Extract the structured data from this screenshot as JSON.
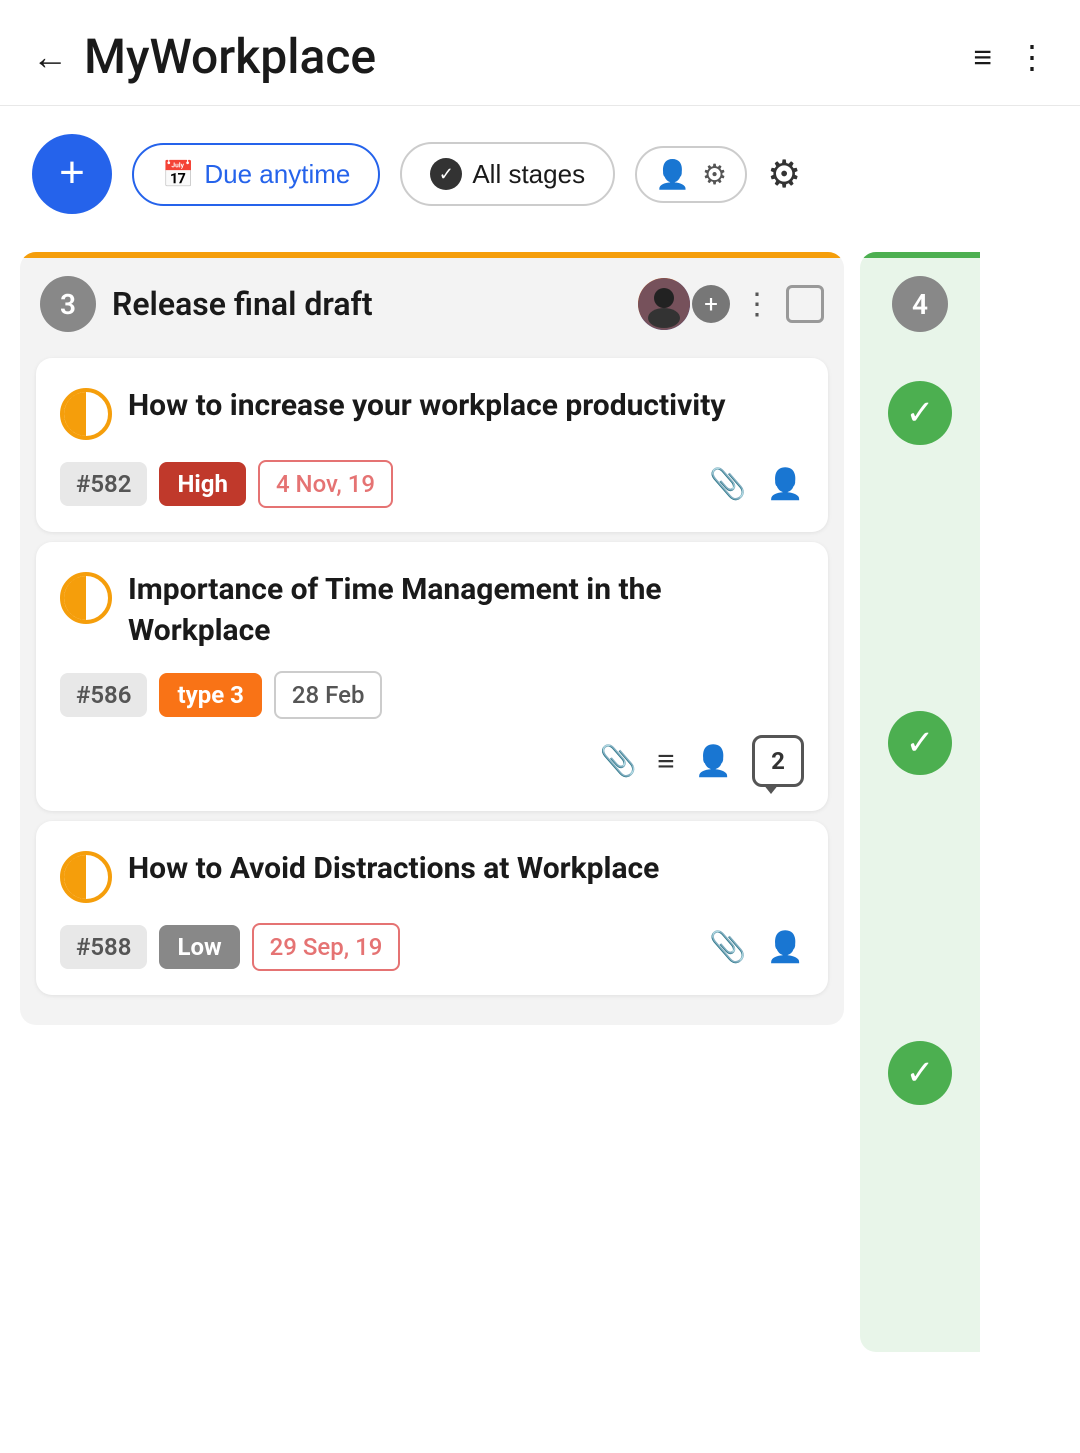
{
  "header": {
    "title": "MyWorkplace",
    "back_label": "←",
    "list_icon": "≡",
    "more_icon": "⋮"
  },
  "toolbar": {
    "add_label": "+",
    "due_anytime_label": "Due anytime",
    "all_stages_label": "All stages"
  },
  "column": {
    "num": "3",
    "title": "Release final draft",
    "top_bar_color": "#f59e0b",
    "tasks": [
      {
        "id": "#582",
        "title": "How to increase your workplace productivity",
        "priority": "High",
        "priority_color": "#c0392b",
        "date": "4 Nov, 19",
        "date_color": "red",
        "has_attachment": true,
        "has_person": true,
        "has_list": false,
        "has_comment": false
      },
      {
        "id": "#586",
        "title": "Importance of Time Management in the Workplace",
        "priority": "type 3",
        "priority_color": "#f97316",
        "date": "28 Feb",
        "date_color": "plain",
        "has_attachment": true,
        "has_person": true,
        "has_list": true,
        "has_comment": true,
        "comment_count": "2"
      },
      {
        "id": "#588",
        "title": "How to Avoid Distractions at Workplace",
        "priority": "Low",
        "priority_color": "#888",
        "date": "29 Sep, 19",
        "date_color": "red",
        "has_attachment": true,
        "has_person": true,
        "has_list": false,
        "has_comment": false
      }
    ]
  },
  "right_column": {
    "num": "4",
    "top_bar_color": "#4caf50",
    "stub_count": 3
  }
}
